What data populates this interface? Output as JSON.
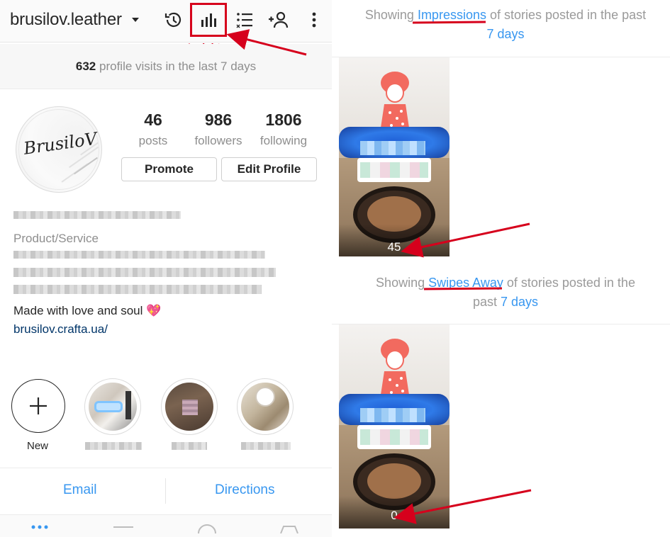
{
  "profile": {
    "username": "brusilov.leather",
    "insights_annotation": "Insights",
    "visits_count": "632",
    "visits_text": "profile visits in the last 7 days",
    "avatar_text": "BrusiloV",
    "stats": [
      {
        "value": "46",
        "label": "posts"
      },
      {
        "value": "986",
        "label": "followers"
      },
      {
        "value": "1806",
        "label": "following"
      }
    ],
    "promote_label": "Promote",
    "edit_profile_label": "Edit Profile",
    "category": "Product/Service",
    "bio_line": "Made with love and soul 💖",
    "bio_link": "brusilov.crafta.ua/",
    "new_highlight_label": "New",
    "email_label": "Email",
    "directions_label": "Directions"
  },
  "insights": {
    "section1": {
      "prefix": "Showing ",
      "metric": "Impressions",
      "suffix": " of stories posted in the past",
      "period": "7 days",
      "story_value": "45"
    },
    "section2": {
      "prefix": "Showing ",
      "metric": "Swipes Away",
      "suffix": " of stories posted in the",
      "period_prefix": "past ",
      "period": "7 days",
      "story_value": "0"
    }
  },
  "colors": {
    "accent_blue": "#3897f0",
    "annotation_red": "#d6001c",
    "link_dark_blue": "#003569"
  }
}
